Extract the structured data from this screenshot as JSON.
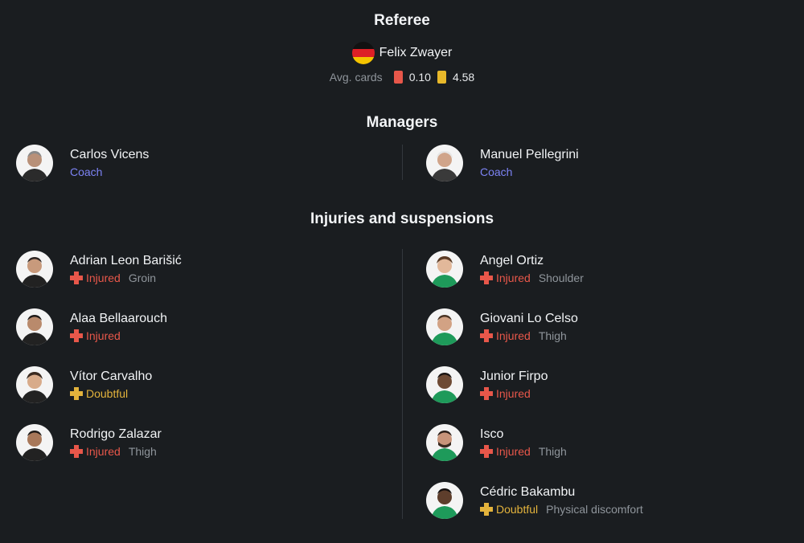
{
  "referee": {
    "title": "Referee",
    "name": "Felix Zwayer",
    "flag_icon": "germany-flag-icon",
    "avg_cards_label": "Avg. cards",
    "red_cards": "0.10",
    "yellow_cards": "4.58",
    "colors": {
      "red": "#e8574a",
      "yellow": "#e8b82a"
    }
  },
  "managers": {
    "title": "Managers",
    "home": {
      "name": "Carlos Vicens",
      "role": "Coach"
    },
    "away": {
      "name": "Manuel Pellegrini",
      "role": "Coach"
    }
  },
  "injuries": {
    "title": "Injuries and suspensions",
    "home": [
      {
        "name": "Adrian Leon Barišić",
        "status": "Injured",
        "reason": "Groin"
      },
      {
        "name": "Alaa Bellaarouch",
        "status": "Injured",
        "reason": ""
      },
      {
        "name": "Vítor Carvalho",
        "status": "Doubtful",
        "reason": ""
      },
      {
        "name": "Rodrigo Zalazar",
        "status": "Injured",
        "reason": "Thigh"
      }
    ],
    "away": [
      {
        "name": "Angel Ortiz",
        "status": "Injured",
        "reason": "Shoulder"
      },
      {
        "name": "Giovani Lo Celso",
        "status": "Injured",
        "reason": "Thigh"
      },
      {
        "name": "Junior Firpo",
        "status": "Injured",
        "reason": ""
      },
      {
        "name": "Isco",
        "status": "Injured",
        "reason": "Thigh"
      },
      {
        "name": "Cédric Bakambu",
        "status": "Doubtful",
        "reason": "Physical discomfort"
      }
    ]
  },
  "colors": {
    "background": "#1a1d20",
    "coach": "#7c83f4",
    "injured": "#e8574a",
    "doubtful": "#e3b33c",
    "muted": "#8f959b",
    "home_kit": "#222222",
    "away_kit": "#1e9a5a"
  }
}
